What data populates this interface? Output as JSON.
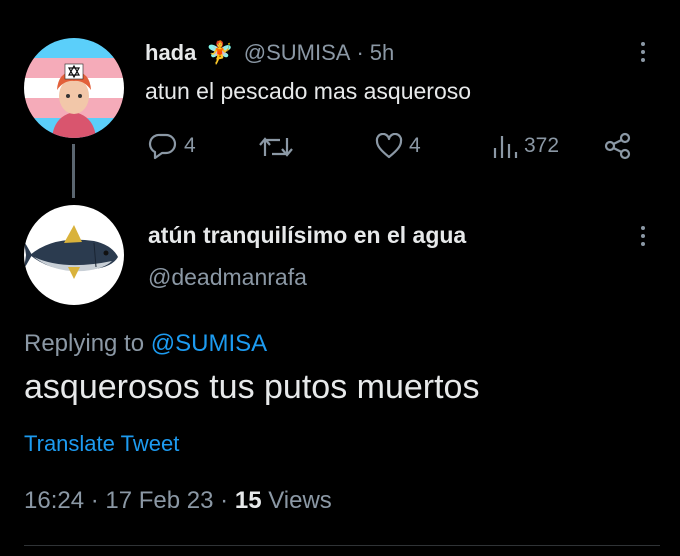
{
  "original_tweet": {
    "display_name": "hada",
    "name_emoji": "🧚",
    "handle": "@SUMISA",
    "separator": "·",
    "time": "5h",
    "text": "atun el pescado mas asqueroso",
    "actions": {
      "reply_count": "4",
      "retweet_count": "",
      "like_count": "4",
      "views_count": "372"
    }
  },
  "reply_tweet": {
    "display_name": "atún tranquilísimo en el agua",
    "handle": "@deadmanrafa",
    "replying_prefix": "Replying to",
    "replying_handle": "@SUMISA",
    "text": "asquerosos tus putos muertos",
    "translate_label": "Translate Tweet",
    "time": "16:24",
    "date": "17 Feb 23",
    "separator": "·",
    "views_count": "15",
    "views_label": "Views"
  },
  "colors": {
    "background": "#000000",
    "text_primary": "#e7e9ea",
    "text_secondary": "#8b98a5",
    "accent": "#1d9bf0",
    "thread_line": "#5b6670"
  },
  "icons": [
    "more-icon",
    "reply-icon",
    "retweet-icon",
    "like-icon",
    "views-icon",
    "share-icon",
    "fairy-emoji"
  ]
}
